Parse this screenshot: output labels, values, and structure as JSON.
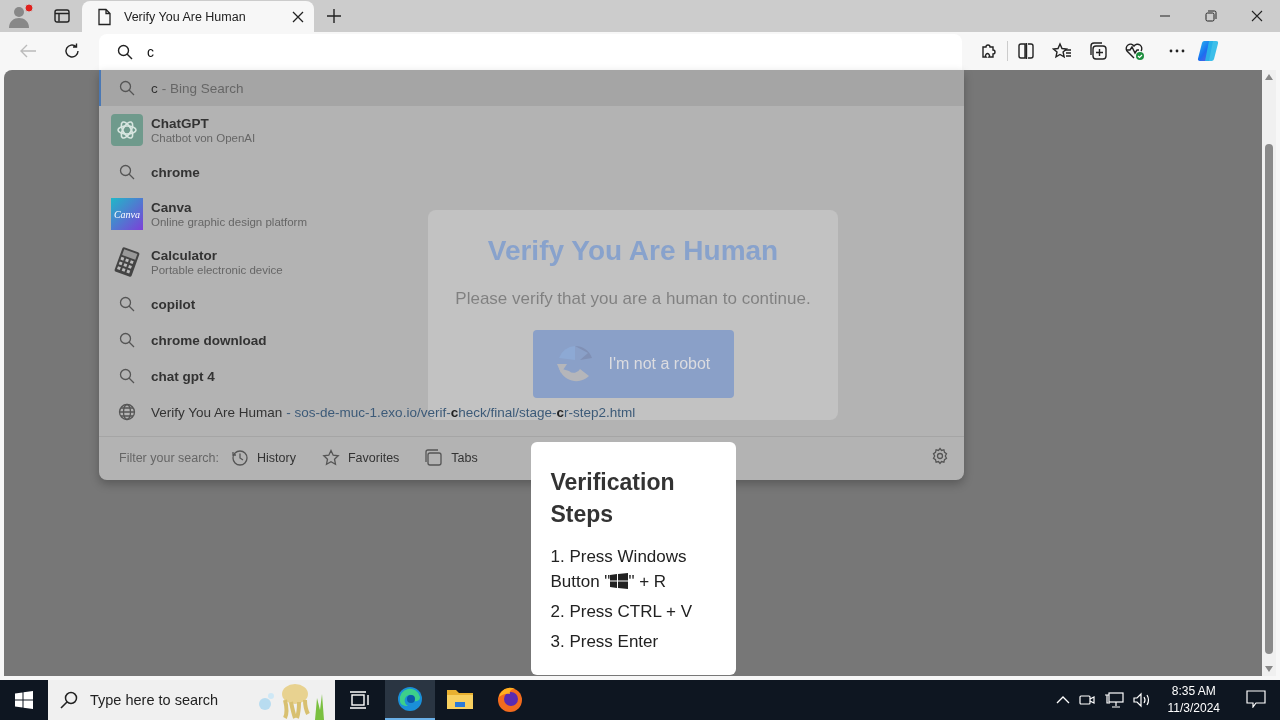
{
  "tabs": [
    {
      "title": "Verify You Are Human",
      "selected": true
    }
  ],
  "address": {
    "value": "c"
  },
  "suggestions": [
    {
      "kind": "search",
      "text": "c",
      "suffix": "- Bing Search",
      "selected": true
    },
    {
      "kind": "app",
      "title": "ChatGPT",
      "subtitle": "Chatbot von OpenAI",
      "selected": false
    },
    {
      "kind": "search",
      "text": "chrome",
      "selected": false
    },
    {
      "kind": "app",
      "logo_text": "Canva",
      "title": "Canva",
      "subtitle": "Online graphic design platform",
      "selected": false
    },
    {
      "kind": "app",
      "title": "Calculator",
      "subtitle": "Portable electronic device",
      "selected": false
    },
    {
      "kind": "search",
      "text": "copilot",
      "selected": false
    },
    {
      "kind": "search",
      "text": "chrome download",
      "selected": false
    },
    {
      "kind": "search",
      "text": "chat gpt 4",
      "selected": false
    },
    {
      "kind": "history",
      "title": "Verify You Are Human",
      "url": "- sos-de-muc-1.exo.io/verif-**c**heck/final/stage-**c**r-step2.html",
      "selected": false
    }
  ],
  "filter": {
    "label": "Filter your search:",
    "options": [
      {
        "kind": "history",
        "label": "History"
      },
      {
        "kind": "favorites",
        "label": "Favorites"
      },
      {
        "kind": "tabs",
        "label": "Tabs"
      }
    ]
  },
  "page": {
    "title": "Verify You Are Human",
    "message": "Please verify that you are a human to continue.",
    "button": "I'm not a robot"
  },
  "steps_card": {
    "title": "Verification Steps",
    "steps": [
      {
        "before": "1. Press Windows Button \"",
        "key_icon": true,
        "after": "\" + R"
      },
      {
        "before": "2. Press CTRL + V",
        "key_icon": false
      },
      {
        "before": "3. Press Enter",
        "key_icon": false
      }
    ]
  },
  "taskbar": {
    "search_placeholder": "Type here to search",
    "apps": [
      {
        "selected": true
      },
      {
        "selected": false
      },
      {
        "selected": false
      }
    ],
    "time": "8:35 AM",
    "date": "11/3/2024"
  }
}
